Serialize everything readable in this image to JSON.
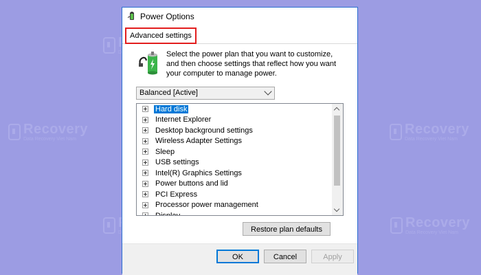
{
  "window": {
    "title": "Power Options",
    "tab": "Advanced settings"
  },
  "description": "Select the power plan that you want to customize, and then choose settings that reflect how you want your computer to manage power.",
  "plan": {
    "selected": "Balanced [Active]"
  },
  "tree": {
    "items": [
      "Hard disk",
      "Internet Explorer",
      "Desktop background settings",
      "Wireless Adapter Settings",
      "Sleep",
      "USB settings",
      "Intel(R) Graphics Settings",
      "Power buttons and lid",
      "PCI Express",
      "Processor power management",
      "Display"
    ],
    "selected_index": 0
  },
  "buttons": {
    "restore": "Restore plan defaults",
    "ok": "OK",
    "cancel": "Cancel",
    "apply": "Apply"
  },
  "watermark": {
    "brand": "Recovery",
    "tagline": "Data Recovery Viet Nam"
  },
  "colors": {
    "background": "#9c9ce3",
    "selection": "#0078d7",
    "tab_highlight": "#e21d1d",
    "title_border": "#2b6fd1"
  },
  "icons": [
    "power-options-app-icon",
    "battery-plug-icon",
    "chevron-down-icon",
    "expand-plus-icon",
    "scroll-up-icon",
    "scroll-down-icon",
    "key-watermark-icon"
  ]
}
